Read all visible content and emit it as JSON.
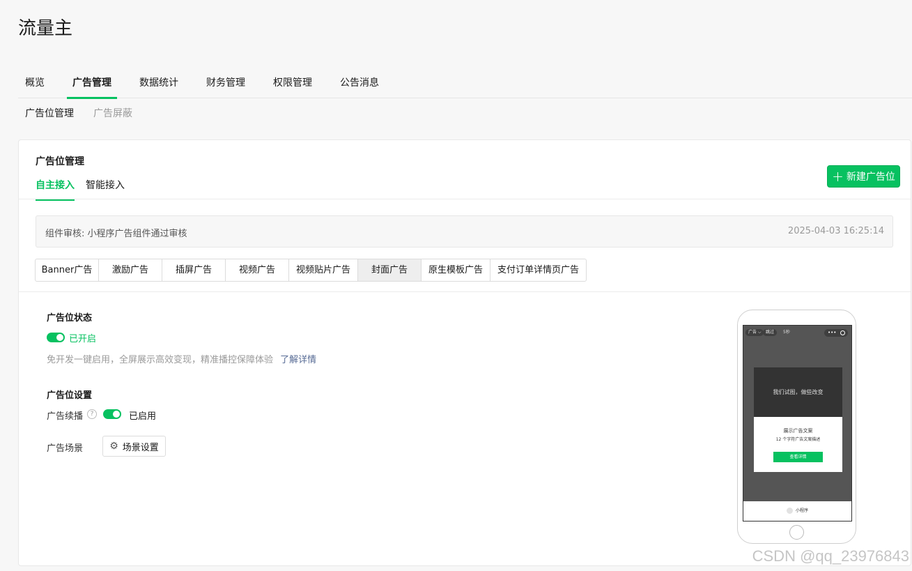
{
  "app": {
    "title": "流量主"
  },
  "top_nav": [
    "概览",
    "广告管理",
    "数据统计",
    "财务管理",
    "权限管理",
    "公告消息"
  ],
  "sub_nav": [
    "广告位管理",
    "广告屏蔽"
  ],
  "card": {
    "title": "广告位管理",
    "tabs": [
      "自主接入",
      "智能接入"
    ],
    "new_button": "新建广告位"
  },
  "notice": {
    "text": "组件审核: 小程序广告组件通过审核",
    "time": "2025-04-03 16:25:14"
  },
  "ad_types": [
    "Banner广告",
    "激励广告",
    "插屏广告",
    "视频广告",
    "视频贴片广告",
    "封面广告",
    "原生模板广告",
    "支付订单详情页广告"
  ],
  "status_section": {
    "title": "广告位状态",
    "status": "已开启",
    "description": "免开发一键启用，全屏展示高效变现，精准播控保障体验",
    "link": "了解详情"
  },
  "settings_section": {
    "title": "广告位设置",
    "continuous_label": "广告续播",
    "help_symbol": "?",
    "continuous_status": "已启用",
    "scene_label": "广告场景",
    "scene_button": "场景设置"
  },
  "preview": {
    "ad_label": "广告 ⌵",
    "skip_label": "跳过",
    "countdown": "5秒",
    "capsule_dots": "•••",
    "image_text": "我们试图，做些改变",
    "copy_title": "展示广告文案",
    "copy_desc": "12 个字符广告文案描述",
    "button": "查看详情",
    "footer": "小程序"
  },
  "watermark": "CSDN @qq_23976843",
  "colors": {
    "accent": "#07c160",
    "link": "#576b95"
  }
}
